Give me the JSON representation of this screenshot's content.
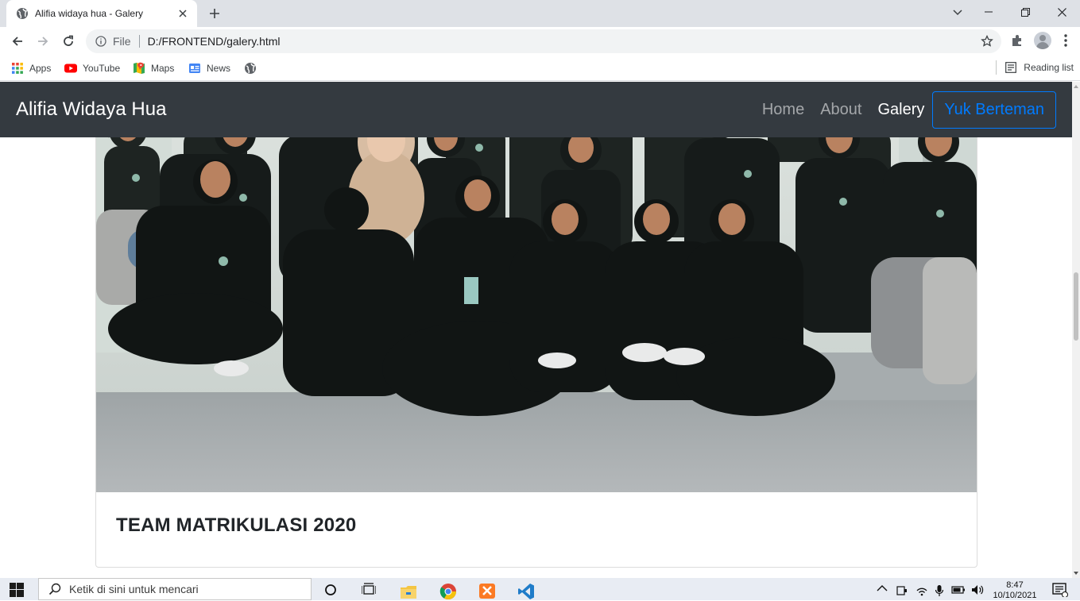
{
  "browser": {
    "tab_title": "Alifia widaya hua - Galery",
    "url_scheme": "File",
    "url": "D:/FRONTEND/galery.html",
    "bookmarks": [
      {
        "label": "Apps",
        "icon": "apps-grid-icon"
      },
      {
        "label": "YouTube",
        "icon": "youtube-icon"
      },
      {
        "label": "Maps",
        "icon": "maps-icon"
      },
      {
        "label": "News",
        "icon": "news-icon"
      }
    ],
    "reading_list": "Reading list"
  },
  "navbar": {
    "brand": "Alifia Widaya Hua",
    "links": [
      {
        "label": "Home",
        "active": false
      },
      {
        "label": "About",
        "active": false
      },
      {
        "label": "Galery",
        "active": true
      }
    ],
    "cta": "Yuk Berteman",
    "bg_color": "#343a40",
    "cta_color": "#007bff"
  },
  "card": {
    "title": "TEAM MATRIKULASI 2020"
  },
  "taskbar": {
    "search_placeholder": "Ketik di sini untuk mencari",
    "time": "8:47",
    "date": "10/10/2021"
  }
}
